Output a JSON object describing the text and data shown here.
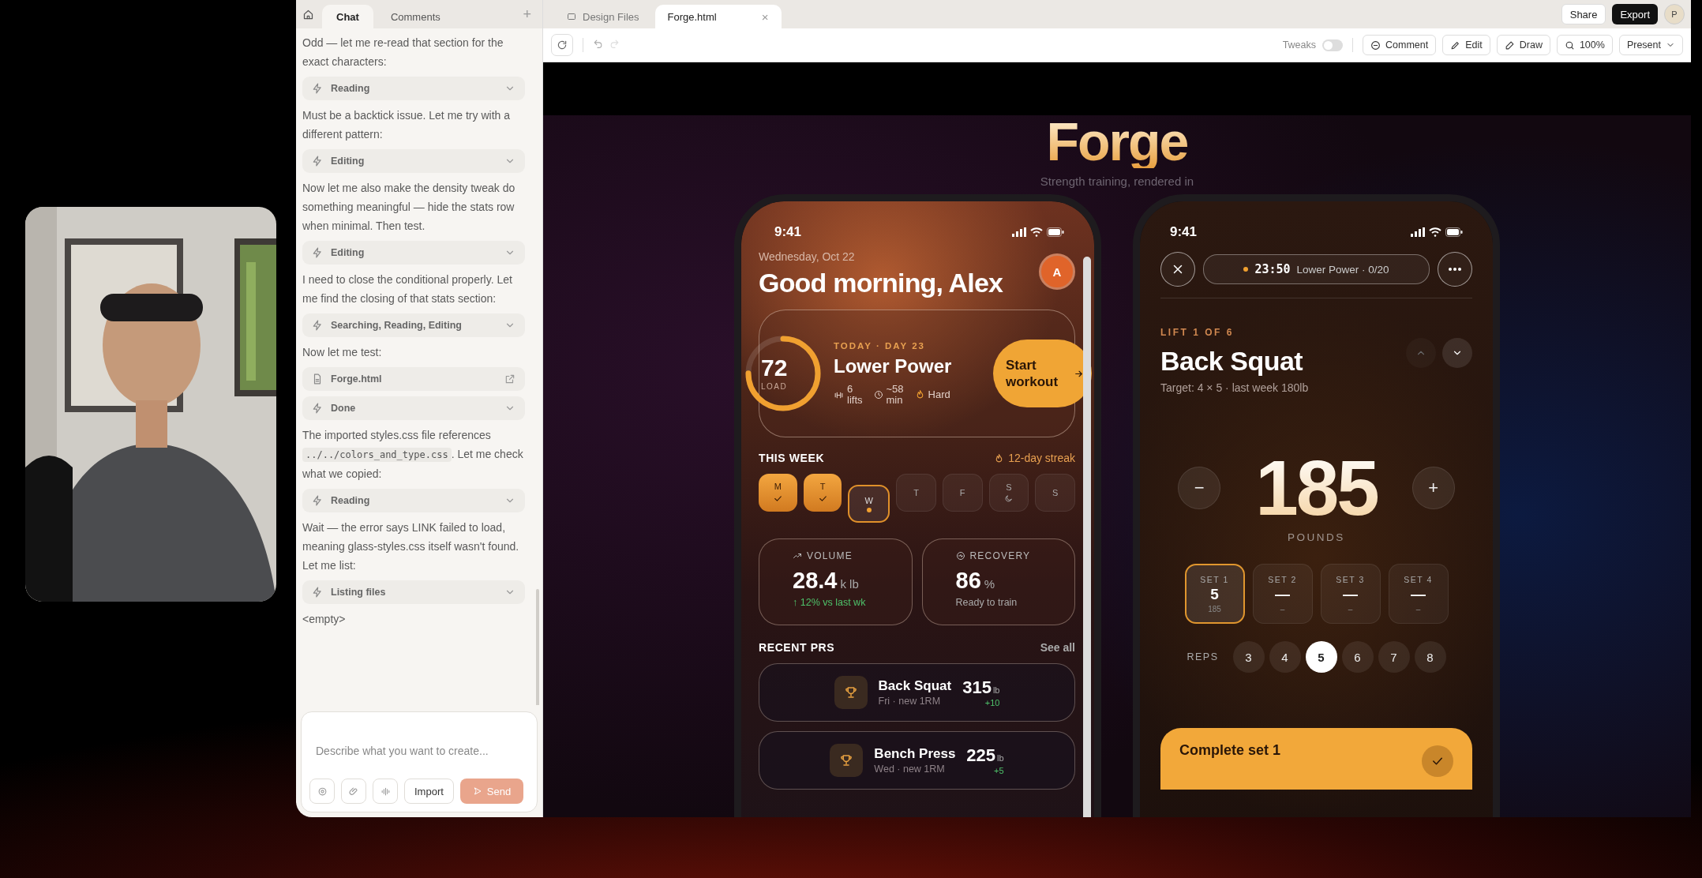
{
  "chat_panel": {
    "tabs": [
      {
        "label": "Chat",
        "selected": true
      },
      {
        "label": "Comments",
        "selected": false
      }
    ],
    "add_tab": "+",
    "messages": [
      {
        "kind": "text",
        "text": "Odd — let me re-read that section for the exact characters:"
      },
      {
        "kind": "step",
        "text": "Reading"
      },
      {
        "kind": "text",
        "text": "Must be a backtick issue. Let me try with a different pattern:"
      },
      {
        "kind": "step",
        "text": "Editing"
      },
      {
        "kind": "text",
        "text": "Now let me also make the density tweak do something meaningful — hide the stats row when minimal. Then test."
      },
      {
        "kind": "step",
        "text": "Editing"
      },
      {
        "kind": "text",
        "text": "I need to close the conditional properly. Let me find the closing of that stats section:"
      },
      {
        "kind": "step",
        "text": "Searching, Reading, Editing"
      },
      {
        "kind": "text",
        "text": "Now let me test:"
      },
      {
        "kind": "file",
        "text": "Forge.html"
      },
      {
        "kind": "step",
        "text": "Done"
      },
      {
        "kind": "code_text",
        "before": "The imported styles.css file references ",
        "code": "../../colors_and_type.css",
        "after": ". Let me check what we copied:"
      },
      {
        "kind": "step",
        "text": "Reading"
      },
      {
        "kind": "text",
        "text": "Wait — the error says LINK failed to load, meaning glass-styles.css itself wasn't found. Let me list:"
      },
      {
        "kind": "step",
        "text": "Listing files"
      },
      {
        "kind": "text",
        "text": "<empty>"
      }
    ],
    "composer": {
      "placeholder": "Describe what you want to create...",
      "import": "Import",
      "send": {
        "label": "Send",
        "disabled": true
      }
    }
  },
  "file_tabs": [
    {
      "label": "Design Files",
      "selected": false
    },
    {
      "label": "Forge.html",
      "selected": true,
      "close": "×"
    }
  ],
  "header_actions": {
    "share": "Share",
    "export": "Export",
    "avatar": "P"
  },
  "toolbar": {
    "tweaks": {
      "label": "Tweaks",
      "on": false
    },
    "buttons": [
      {
        "kind": "comment",
        "label": "Comment"
      },
      {
        "kind": "edit",
        "label": "Edit"
      },
      {
        "kind": "draw",
        "label": "Draw"
      },
      {
        "kind": "zoom",
        "label": "100%"
      },
      {
        "kind": "present",
        "label": "Present"
      }
    ]
  },
  "preview": {
    "title": "Forge",
    "subtitle": "Strength training, rendered in",
    "home_screen": {
      "time": "9:41",
      "date": "Wednesday, Oct 22",
      "greeting": "Good morning, Alex",
      "avatar": "A",
      "today": {
        "load": "72",
        "load_label": "LOAD",
        "level": 0.75,
        "eyebrow": "TODAY · DAY 23",
        "title": "Lower Power",
        "meta": [
          {
            "kind": "lifts",
            "value": "6",
            "unit": "lifts"
          },
          {
            "kind": "time",
            "value": "~58",
            "unit": "min"
          },
          {
            "kind": "intensity",
            "value": "Hard"
          }
        ],
        "start": "Start workout"
      },
      "week": {
        "title": "THIS WEEK",
        "streak": "12-day streak",
        "days": [
          {
            "label": "M",
            "kind": "done"
          },
          {
            "label": "T",
            "kind": "done"
          },
          {
            "label": "W",
            "kind": "today"
          },
          {
            "label": "T",
            "kind": "upcoming"
          },
          {
            "label": "F",
            "kind": "upcoming"
          },
          {
            "label": "S",
            "kind": "rest"
          },
          {
            "label": "S",
            "kind": "upcoming"
          }
        ]
      },
      "stats": [
        {
          "kind": "volume",
          "label": "VOLUME",
          "value": "28.4",
          "unit": "k lb",
          "note": "↑ 12% vs last wk",
          "positive": true
        },
        {
          "kind": "recovery",
          "label": "RECOVERY",
          "value": "86",
          "unit": "%",
          "note": "Ready to train",
          "positive": false
        }
      ],
      "prs": {
        "title": "RECENT PRS",
        "see_all": "See all",
        "items": [
          {
            "name": "Back Squat",
            "detail": "Fri · new 1RM",
            "value": "315",
            "unit": "lb",
            "delta": "+10"
          },
          {
            "name": "Bench Press",
            "detail": "Wed · new 1RM",
            "value": "225",
            "unit": "lb",
            "delta": "+5"
          }
        ]
      }
    },
    "workout_screen": {
      "time": "9:41",
      "timer": "23:50",
      "session": "Lower Power · 0/20",
      "eyebrow": "LIFT 1 OF 6",
      "title": "Back Squat",
      "target": "Target: 4 × 5 · last week 180lb",
      "prev_disabled": true,
      "minus": "−",
      "weight": "185",
      "plus": "+",
      "unit": "POUNDS",
      "sets": [
        {
          "label": "SET 1",
          "reps": "5",
          "weight": "185",
          "selected": true
        },
        {
          "label": "SET 2",
          "reps": "—",
          "weight": "–",
          "selected": false
        },
        {
          "label": "SET 3",
          "reps": "—",
          "weight": "–",
          "selected": false
        },
        {
          "label": "SET 4",
          "reps": "—",
          "weight": "–",
          "selected": false
        }
      ],
      "reps_label": "REPS",
      "reps": [
        {
          "label": "3",
          "selected": false
        },
        {
          "label": "4",
          "selected": false
        },
        {
          "label": "5",
          "selected": true
        },
        {
          "label": "6",
          "selected": false
        },
        {
          "label": "7",
          "selected": false
        },
        {
          "label": "8",
          "selected": false
        }
      ],
      "complete": "Complete set 1"
    }
  }
}
